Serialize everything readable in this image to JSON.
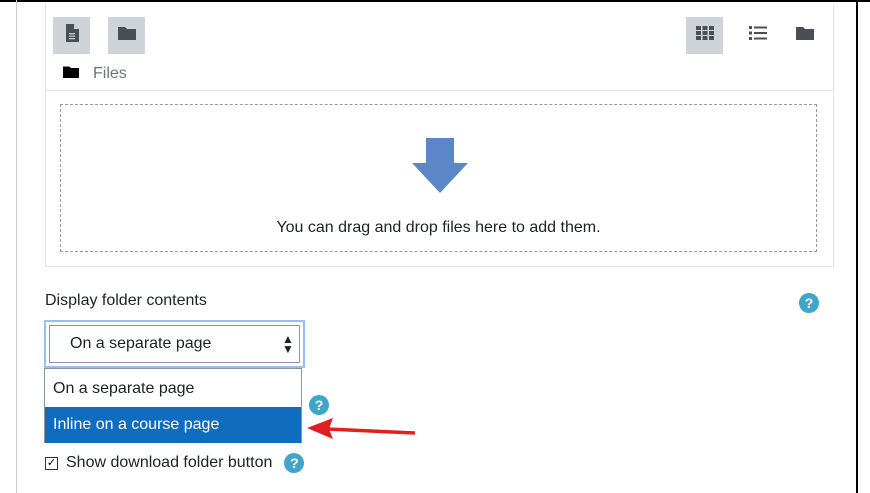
{
  "filemanager": {
    "path_label": "Files",
    "drop_text": "You can drag and drop files here to add them.",
    "toolbar_icons": {
      "left": [
        "file-icon",
        "folder-icon"
      ],
      "right": [
        "grid-view-icon",
        "list-view-icon",
        "folder-view-icon"
      ],
      "active_view": "grid-view-icon"
    }
  },
  "display_folder": {
    "label": "Display folder contents",
    "selected_value": "On a separate page",
    "options": [
      "On a separate page",
      "Inline on a course page"
    ],
    "highlighted_option": "Inline on a course page"
  },
  "download_button": {
    "label": "Show download folder button",
    "checked": true
  },
  "colors": {
    "help_icon": "#40a5c8",
    "highlight": "#0f6cbf",
    "arrow_blue": "#5b87c8",
    "annotation_red": "#e02020"
  }
}
